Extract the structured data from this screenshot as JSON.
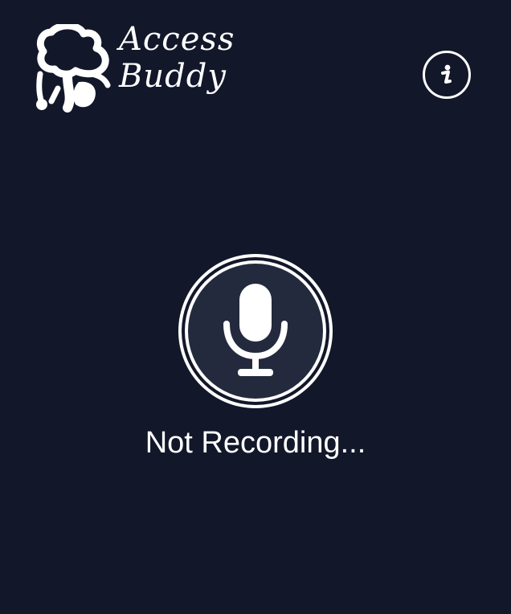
{
  "app": {
    "logo_line1": "Access",
    "logo_line2": "Buddy"
  },
  "header": {
    "info_icon": "info-icon"
  },
  "recorder": {
    "mic_icon": "microphone-icon",
    "status": "Not Recording..."
  },
  "colors": {
    "background": "#12172a",
    "button_face": "#232a3d",
    "foreground": "#ffffff"
  }
}
